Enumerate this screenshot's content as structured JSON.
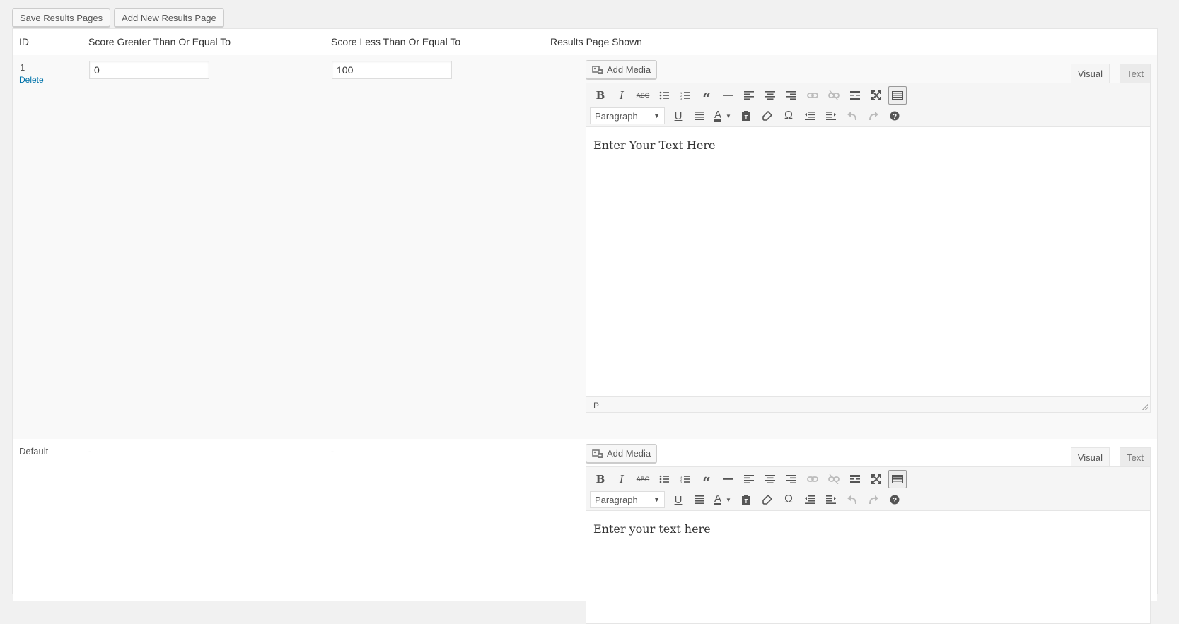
{
  "toolbar_top": {
    "save_label": "Save Results Pages",
    "add_label": "Add New Results Page"
  },
  "table": {
    "headers": [
      "ID",
      "Score Greater Than Or Equal To",
      "Score Less Than Or Equal To",
      "Results Page Shown"
    ],
    "rows": [
      {
        "id": "1",
        "delete_label": "Delete",
        "score_min": "0",
        "score_max": "100",
        "editor": {
          "add_media_label": "Add Media",
          "tab_visual": "Visual",
          "tab_text": "Text",
          "format_select": "Paragraph",
          "content": "Enter Your Text Here",
          "status_path": "P"
        }
      },
      {
        "id": "Default",
        "score_min": "-",
        "score_max": "-",
        "editor": {
          "add_media_label": "Add Media",
          "tab_visual": "Visual",
          "tab_text": "Text",
          "format_select": "Paragraph",
          "content": "Enter your text here"
        }
      }
    ]
  },
  "colors": {
    "link": "#0073aa",
    "page_bg": "#f1f1f1",
    "row_alt_bg": "#f9f9f9"
  },
  "icons": {
    "toolbar_row1": [
      "bold-icon",
      "italic-icon",
      "strikethrough-icon",
      "bullet-list-icon",
      "numbered-list-icon",
      "blockquote-icon",
      "horizontal-rule-icon",
      "align-left-icon",
      "align-center-icon",
      "align-right-icon",
      "link-icon",
      "unlink-icon",
      "read-more-icon",
      "fullscreen-icon",
      "toolbar-toggle-icon"
    ],
    "toolbar_row2": [
      "format-select",
      "underline-icon",
      "justify-icon",
      "text-color-icon",
      "paste-text-icon",
      "clear-formatting-icon",
      "special-character-icon",
      "outdent-icon",
      "indent-icon",
      "undo-icon",
      "redo-icon",
      "help-icon"
    ]
  }
}
